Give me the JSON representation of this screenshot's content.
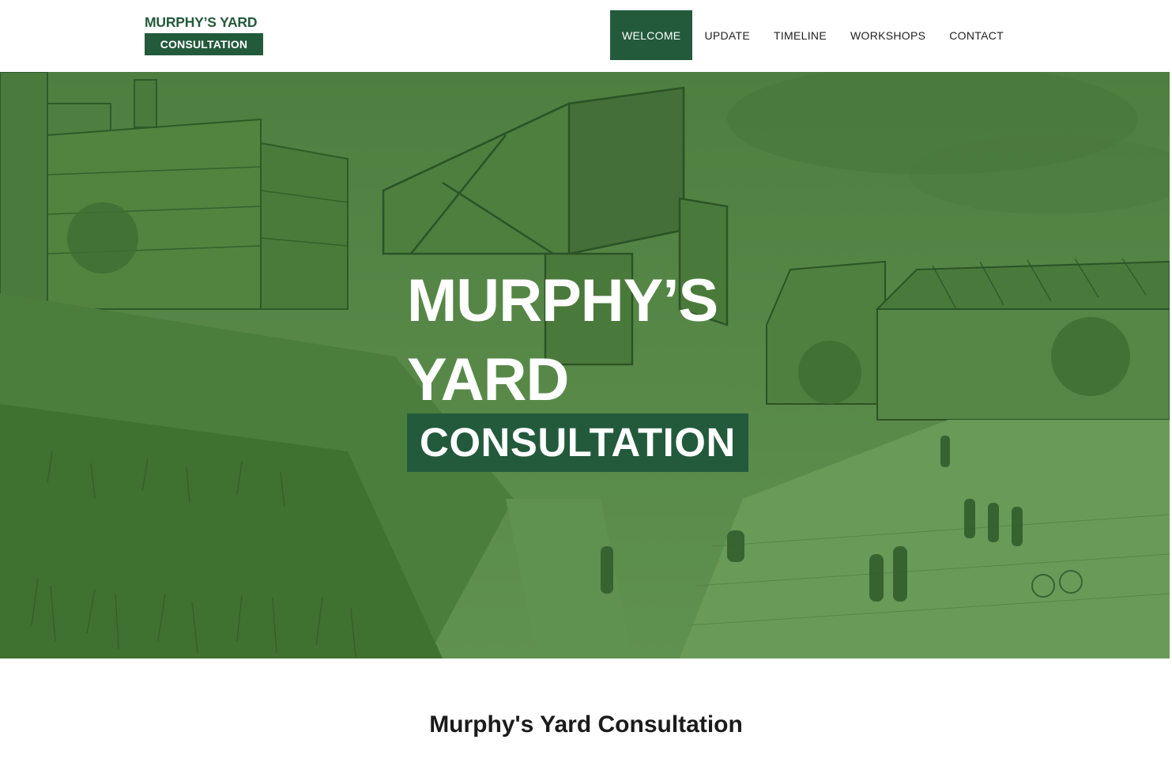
{
  "logo": {
    "title": "MURPHY’S YARD",
    "subtitle": "CONSULTATION"
  },
  "nav": {
    "items": [
      {
        "label": "WELCOME",
        "active": true
      },
      {
        "label": "UPDATE",
        "active": false
      },
      {
        "label": "TIMELINE",
        "active": false
      },
      {
        "label": "WORKSHOPS",
        "active": false
      },
      {
        "label": "CONTACT",
        "active": false
      }
    ]
  },
  "hero": {
    "line1": "MURPHY’S",
    "line2": "YARD",
    "box": "CONSULTATION",
    "image": "green-tinted architectural sketch"
  },
  "content": {
    "title": "Murphy's Yard Consultation"
  },
  "colors": {
    "brand": "#235a3c",
    "hero_tint": "#5a8c48"
  }
}
